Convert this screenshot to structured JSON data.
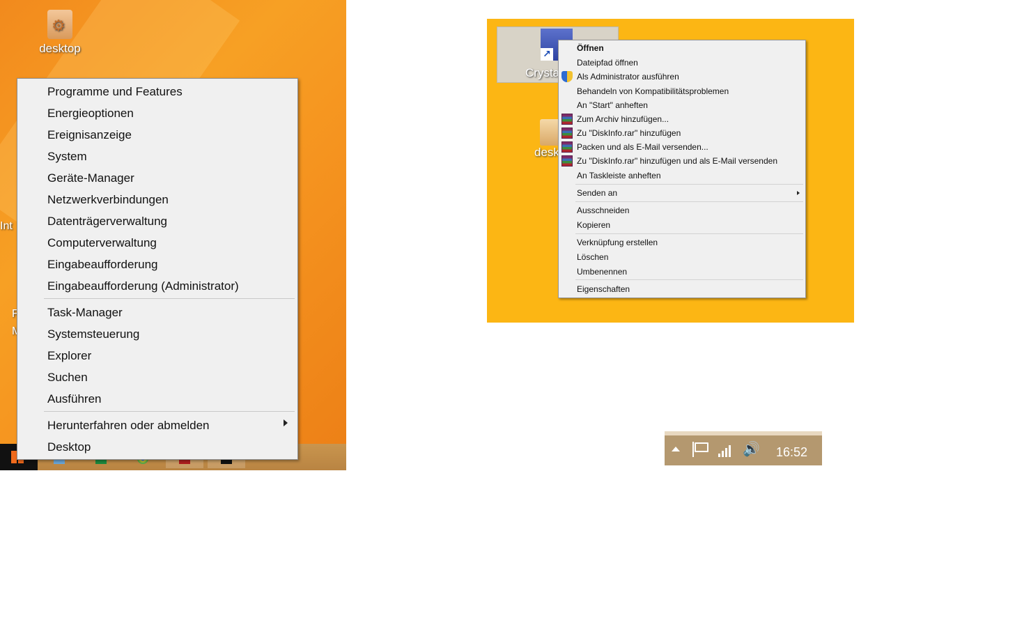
{
  "left_panel": {
    "desktop_icon_label": "desktop",
    "edge_texts": [
      "Int",
      "F",
      "M"
    ],
    "menu_items_group1": [
      "Programme und Features",
      "Energieoptionen",
      "Ereignisanzeige",
      "System",
      "Geräte-Manager",
      "Netzwerkverbindungen",
      "Datenträgerverwaltung",
      "Computerverwaltung",
      "Eingabeaufforderung",
      "Eingabeaufforderung (Administrator)"
    ],
    "menu_items_group2": [
      "Task-Manager",
      "Systemsteuerung",
      "Explorer",
      "Suchen",
      "Ausführen"
    ],
    "menu_items_group3": [
      "Herunterfahren oder abmelden",
      "Desktop"
    ]
  },
  "right_panel": {
    "shortcut_label": "CrystalD",
    "desktop_icon_label": "desk",
    "context_menu": {
      "open": "Öffnen",
      "open_path": "Dateipfad öffnen",
      "run_as_admin": "Als Administrator ausführen",
      "troubleshoot": "Behandeln von Kompatibilitätsproblemen",
      "pin_start": "An \"Start\" anheften",
      "add_archive": "Zum Archiv hinzufügen...",
      "add_diskinfo_rar": "Zu \"DiskInfo.rar\" hinzufügen",
      "pack_email": "Packen und als E-Mail versenden...",
      "add_rar_email": "Zu \"DiskInfo.rar\" hinzufügen und als E-Mail versenden",
      "pin_taskbar": "An Taskleiste anheften",
      "send_to": "Senden an",
      "cut": "Ausschneiden",
      "copy": "Kopieren",
      "create_shortcut": "Verknüpfung erstellen",
      "delete": "Löschen",
      "rename": "Umbenennen",
      "properties": "Eigenschaften"
    }
  },
  "tray": {
    "clock": "16:52"
  },
  "colors": {
    "left_desktop": "#f5931f",
    "right_desktop": "#fcb614",
    "menu_bg": "#f0f0f0"
  }
}
